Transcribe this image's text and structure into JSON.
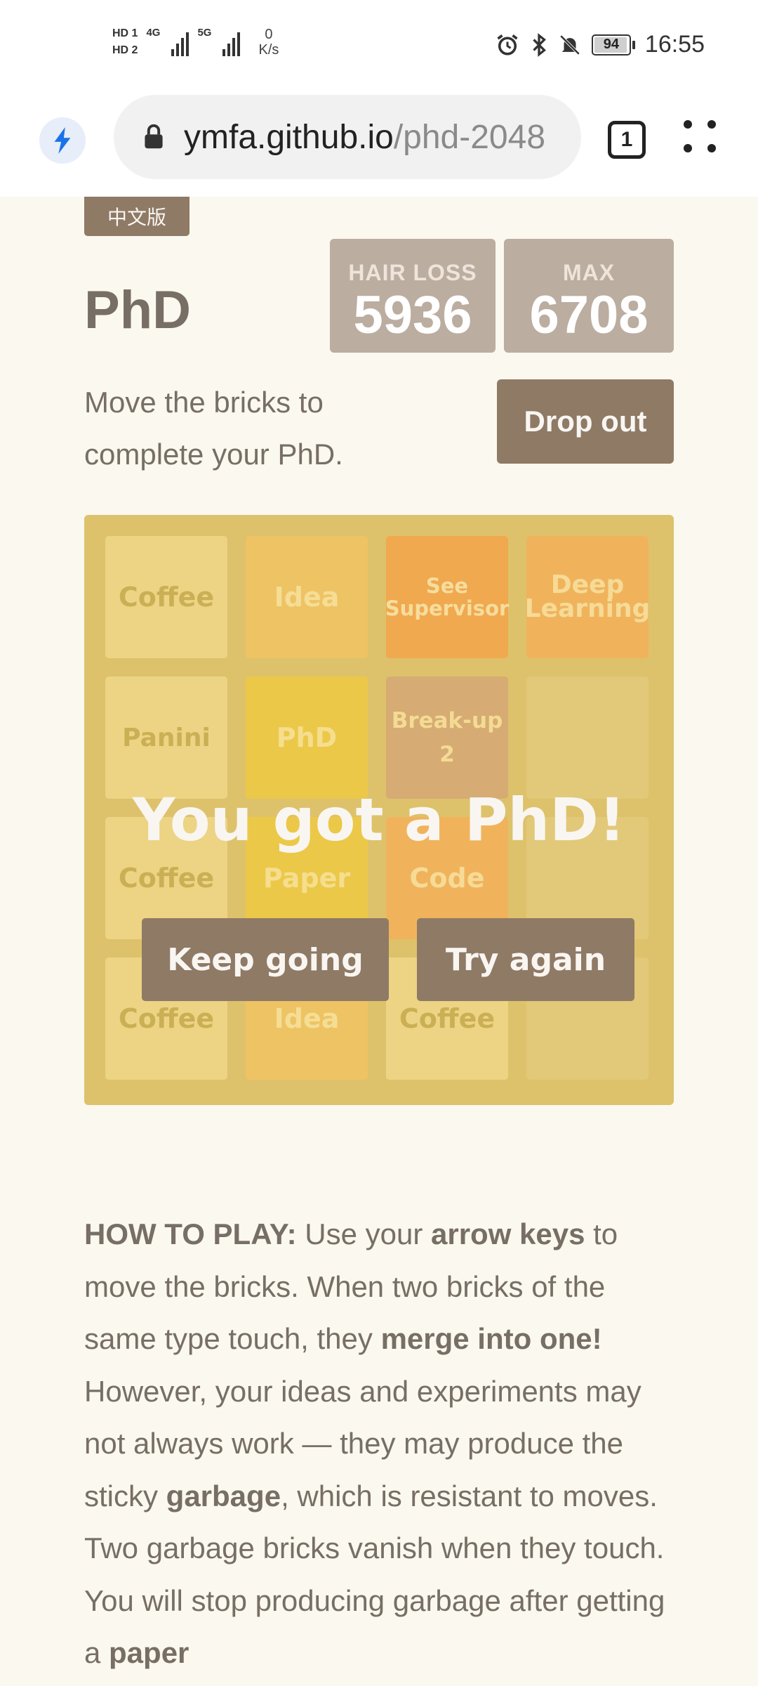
{
  "status_bar": {
    "hd1": "HD 1",
    "hd2": "HD 2",
    "net1": "4G",
    "net2": "5G",
    "speed_value": "0",
    "speed_unit": "K/s",
    "battery": "94",
    "time": "16:55",
    "icons": [
      "alarm-icon",
      "bluetooth-icon",
      "silent-icon",
      "battery-icon"
    ]
  },
  "browser": {
    "url_host": "ymfa.github.io",
    "url_path": "/phd-2048",
    "tab_count": "1",
    "accent": "#1a73e8"
  },
  "header": {
    "lang_button": "中文版",
    "title": "PhD",
    "score_label": "HAIR LOSS",
    "score_value": "5936",
    "best_label": "MAX",
    "best_value": "6708",
    "intro": "Move the bricks to complete your PhD.",
    "dropout_button": "Drop out"
  },
  "board": {
    "tiles": [
      {
        "label": "Coffee",
        "type": "coffee"
      },
      {
        "label": "Idea",
        "type": "idea"
      },
      {
        "label": "See Supervisor",
        "type": "seesup"
      },
      {
        "label": "Deep Learning",
        "type": "deep"
      },
      {
        "label": "Panini",
        "type": "panini"
      },
      {
        "label": "PhD",
        "type": "phd"
      },
      {
        "label": "Break-up 2",
        "type": "breakup"
      },
      {
        "label": "",
        "type": "empty"
      },
      {
        "label": "Coffee",
        "type": "coffee"
      },
      {
        "label": "Paper",
        "type": "paper"
      },
      {
        "label": "Code",
        "type": "code"
      },
      {
        "label": "",
        "type": "empty"
      },
      {
        "label": "Coffee",
        "type": "coffee"
      },
      {
        "label": "Idea",
        "type": "idea"
      },
      {
        "label": "Coffee",
        "type": "coffee"
      },
      {
        "label": "",
        "type": "empty"
      }
    ],
    "message": "You got a PhD!",
    "keep_going": "Keep going",
    "try_again": "Try again"
  },
  "howto": {
    "p1": "HOW TO PLAY:",
    "p2": " Use your ",
    "p3": "arrow keys",
    "p4": " to move the bricks. When two bricks of the same type touch, they ",
    "p5": "merge into one!",
    "p6": " However, your ideas and experiments may not always work — they may produce the sticky ",
    "p7": "garbage",
    "p8": ", which is resistant to moves. Two garbage bricks vanish when they touch. You will stop producing garbage after getting a ",
    "p9": "paper"
  },
  "colors": {
    "background": "#faf8ef",
    "board": "#d4b964",
    "button": "#8f7a66",
    "scorebox": "#bbada0",
    "text": "#776e65"
  }
}
